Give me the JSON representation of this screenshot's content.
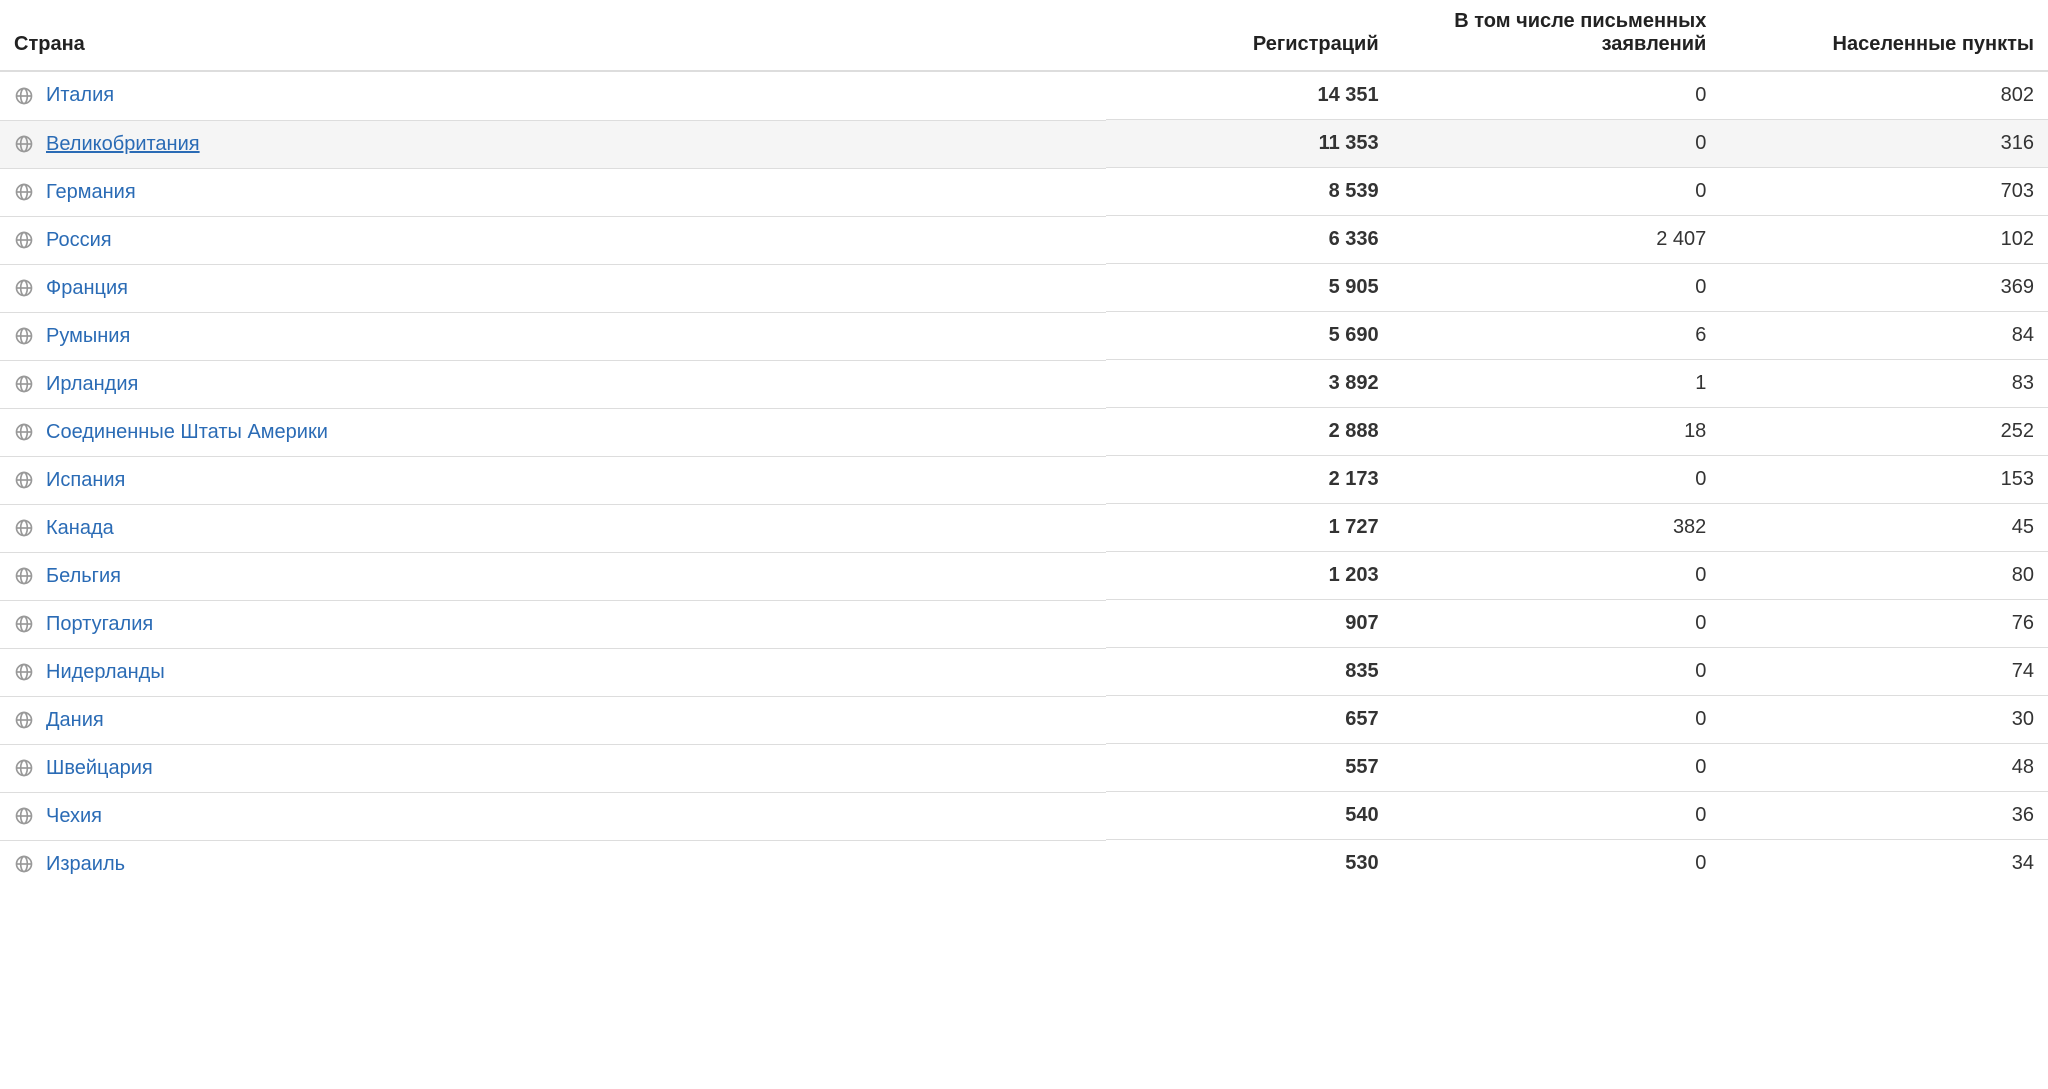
{
  "columns": {
    "country": "Страна",
    "registrations": "Регистраций",
    "written": "В том числе письменных заявлений",
    "places": "Населенные пункты"
  },
  "hovered_index": 1,
  "rows": [
    {
      "country": "Италия",
      "registrations": "14 351",
      "written": "0",
      "places": "802"
    },
    {
      "country": "Великобритания",
      "registrations": "11 353",
      "written": "0",
      "places": "316"
    },
    {
      "country": "Германия",
      "registrations": "8 539",
      "written": "0",
      "places": "703"
    },
    {
      "country": "Россия",
      "registrations": "6 336",
      "written": "2 407",
      "places": "102"
    },
    {
      "country": "Франция",
      "registrations": "5 905",
      "written": "0",
      "places": "369"
    },
    {
      "country": "Румыния",
      "registrations": "5 690",
      "written": "6",
      "places": "84"
    },
    {
      "country": "Ирландия",
      "registrations": "3 892",
      "written": "1",
      "places": "83"
    },
    {
      "country": "Соединенные Штаты Америки",
      "registrations": "2 888",
      "written": "18",
      "places": "252"
    },
    {
      "country": "Испания",
      "registrations": "2 173",
      "written": "0",
      "places": "153"
    },
    {
      "country": "Канада",
      "registrations": "1 727",
      "written": "382",
      "places": "45"
    },
    {
      "country": "Бельгия",
      "registrations": "1 203",
      "written": "0",
      "places": "80"
    },
    {
      "country": "Португалия",
      "registrations": "907",
      "written": "0",
      "places": "76"
    },
    {
      "country": "Нидерланды",
      "registrations": "835",
      "written": "0",
      "places": "74"
    },
    {
      "country": "Дания",
      "registrations": "657",
      "written": "0",
      "places": "30"
    },
    {
      "country": "Швейцария",
      "registrations": "557",
      "written": "0",
      "places": "48"
    },
    {
      "country": "Чехия",
      "registrations": "540",
      "written": "0",
      "places": "36"
    },
    {
      "country": "Израиль",
      "registrations": "530",
      "written": "0",
      "places": "34"
    }
  ]
}
